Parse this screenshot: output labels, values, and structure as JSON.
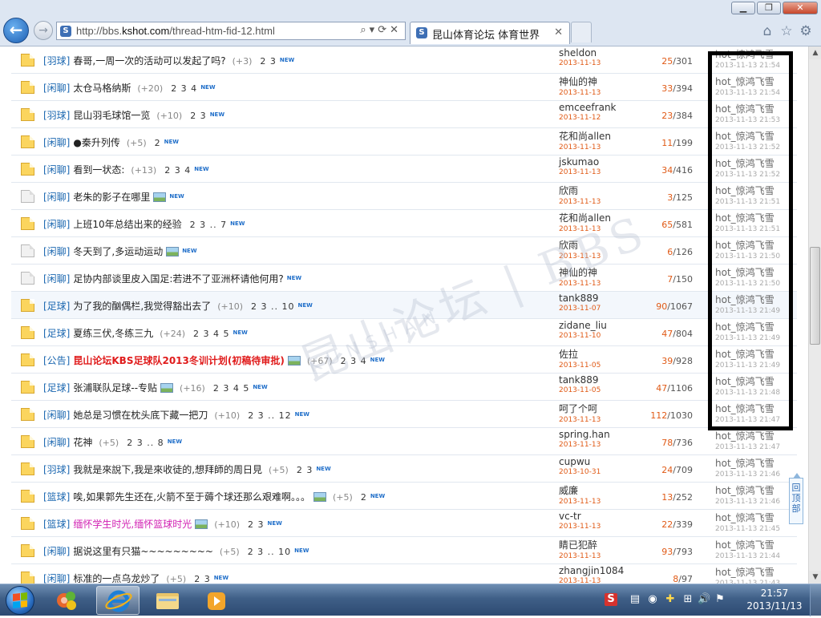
{
  "browser": {
    "url_prefix": "http://bbs.",
    "url_domain": "kshot.com",
    "url_path": "/thread-htm-fid-12.html",
    "tab_title": "昆山体育论坛 体育世界",
    "tab_close": "✕",
    "min_label": "▁",
    "max_label": "❐",
    "close_label": "✕",
    "back_glyph": "←",
    "fwd_glyph": "→",
    "address_tools": "⌕▾⟳✕",
    "home_glyph": "⌂",
    "fav_glyph": "☆",
    "gear_glyph": "⚙",
    "favicon_letter": "S"
  },
  "partial_top": {
    "stats": "/258",
    "last_date": "2013-11-13 21:55",
    "author_date": "2013-11-13"
  },
  "threads": [
    {
      "cat": "[羽球]",
      "title": "春哥,一周一次的活动可以发起了吗?",
      "plus": "(+3)",
      "pages": "2 3",
      "new": "NEW",
      "icon": "hot",
      "author": "sheldon",
      "adate": "2013-11-13",
      "replies": "25",
      "views": "/301",
      "last": "hot_惊鸿飞雪",
      "ldate": "2013-11-13 21:54"
    },
    {
      "cat": "[闲聊]",
      "title": "太仓马格纳斯",
      "plus": "(+20)",
      "pages": "2 3 4",
      "new": "NEW",
      "icon": "hot",
      "author": "神仙的神",
      "adate": "2013-11-13",
      "replies": "33",
      "views": "/394",
      "last": "hot_惊鸿飞雪",
      "ldate": "2013-11-13 21:54"
    },
    {
      "cat": "[羽球]",
      "title": "昆山羽毛球馆一览",
      "plus": "(+10)",
      "pages": "2 3",
      "new": "NEW",
      "icon": "hot",
      "author": "emceefrank",
      "adate": "2013-11-12",
      "replies": "23",
      "views": "/384",
      "last": "hot_惊鸿飞雪",
      "ldate": "2013-11-13 21:53"
    },
    {
      "cat": "[闲聊]",
      "title": "●秦升列传",
      "plus": "(+5)",
      "pages": "2",
      "new": "NEW",
      "icon": "hot",
      "author": "花和尚allen",
      "adate": "2013-11-13",
      "replies": "11",
      "views": "/199",
      "last": "hot_惊鸿飞雪",
      "ldate": "2013-11-13 21:52"
    },
    {
      "cat": "[闲聊]",
      "title": "看到一状态:",
      "plus": "(+13)",
      "pages": "2 3 4",
      "new": "NEW",
      "icon": "hot",
      "author": "jskumao",
      "adate": "2013-11-13",
      "replies": "34",
      "views": "/416",
      "last": "hot_惊鸿飞雪",
      "ldate": "2013-11-13 21:52"
    },
    {
      "cat": "[闲聊]",
      "title": "老朱的影子在哪里",
      "plus": "",
      "pages": "",
      "new": "NEW",
      "icon": "normal",
      "pic": true,
      "author": "欣雨",
      "adate": "2013-11-13",
      "replies": "3",
      "views": "/125",
      "last": "hot_惊鸿飞雪",
      "ldate": "2013-11-13 21:51"
    },
    {
      "cat": "[闲聊]",
      "title": "上班10年总结出来的经验",
      "plus": "",
      "pages": "2 3 .. 7",
      "new": "NEW",
      "icon": "hot",
      "author": "花和尚allen",
      "adate": "2013-11-13",
      "replies": "65",
      "views": "/581",
      "last": "hot_惊鸿飞雪",
      "ldate": "2013-11-13 21:51"
    },
    {
      "cat": "[闲聊]",
      "title": "冬天到了,多运动运动",
      "plus": "",
      "pages": "",
      "new": "NEW",
      "icon": "normal",
      "pic": true,
      "author": "欣雨",
      "adate": "2013-11-13",
      "replies": "6",
      "views": "/126",
      "last": "hot_惊鸿飞雪",
      "ldate": "2013-11-13 21:50"
    },
    {
      "cat": "[闲聊]",
      "title": "足协内部谈里皮入国足:若进不了亚洲杯请他何用?",
      "plus": "",
      "pages": "",
      "new": "NEW",
      "icon": "normal",
      "author": "神仙的神",
      "adate": "2013-11-13",
      "replies": "7",
      "views": "/150",
      "last": "hot_惊鸿飞雪",
      "ldate": "2013-11-13 21:50"
    },
    {
      "cat": "[足球]",
      "title": "为了我的酗偶栏,我觉得豁出去了",
      "plus": "(+10)",
      "pages": "2 3 .. 10",
      "new": "NEW",
      "icon": "hot",
      "author": "tank889",
      "adate": "2013-11-07",
      "replies": "90",
      "views": "/1067",
      "last": "hot_惊鸿飞雪",
      "ldate": "2013-11-13 21:49"
    },
    {
      "cat": "[足球]",
      "title": "夏练三伏,冬练三九",
      "plus": "(+24)",
      "pages": "2 3 4 5",
      "new": "NEW",
      "icon": "hot",
      "author": "zidane_liu",
      "adate": "2013-11-10",
      "replies": "47",
      "views": "/804",
      "last": "hot_惊鸿飞雪",
      "ldate": "2013-11-13 21:49"
    },
    {
      "cat": "[公告]",
      "title": "昆山论坛KBS足球队2013冬训计划(初稿待审批)",
      "plus": "(+67)",
      "pages": "2 3 4",
      "new": "NEW",
      "icon": "hot",
      "style": "red",
      "pic": true,
      "author": "佐拉",
      "adate": "2013-11-05",
      "replies": "39",
      "views": "/928",
      "last": "hot_惊鸿飞雪",
      "ldate": "2013-11-13 21:49"
    },
    {
      "cat": "[足球]",
      "title": "张浦联队足球--专贴",
      "plus": "(+16)",
      "pages": "2 3 4 5",
      "new": "NEW",
      "icon": "hot",
      "pic": true,
      "author": "tank889",
      "adate": "2013-11-05",
      "replies": "47",
      "views": "/1106",
      "last": "hot_惊鸿飞雪",
      "ldate": "2013-11-13 21:48"
    },
    {
      "cat": "[闲聊]",
      "title": "她总是习惯在枕头底下藏一把刀",
      "plus": "(+10)",
      "pages": "2 3 .. 12",
      "new": "NEW",
      "icon": "hot",
      "author": "呵了个呵",
      "adate": "2013-11-13",
      "replies": "112",
      "views": "/1030",
      "last": "hot_惊鸿飞雪",
      "ldate": "2013-11-13 21:47"
    },
    {
      "cat": "[闲聊]",
      "title": "花神",
      "plus": "(+5)",
      "pages": "2 3 .. 8",
      "new": "NEW",
      "icon": "hot",
      "author": "spring.han",
      "adate": "2013-11-13",
      "replies": "78",
      "views": "/736",
      "last": "hot_惊鸿飞雪",
      "ldate": "2013-11-13 21:47"
    },
    {
      "cat": "[羽球]",
      "title": "我就是來說下,我是來收徒的,想拜師的周日見",
      "plus": "(+5)",
      "pages": "2 3",
      "new": "NEW",
      "icon": "hot",
      "author": "cupwu",
      "adate": "2013-10-31",
      "replies": "24",
      "views": "/709",
      "last": "hot_惊鸿飞雪",
      "ldate": "2013-11-13 21:46"
    },
    {
      "cat": "[篮球]",
      "title": "唉,如果郭先生还在,火箭不至于薅个球还那么艰难啊。。。",
      "plus": "(+5)",
      "pages": "2",
      "new": "NEW",
      "icon": "hot",
      "pic": true,
      "author": "威廉",
      "adate": "2013-11-13",
      "replies": "13",
      "views": "/252",
      "last": "hot_惊鸿飞雪",
      "ldate": "2013-11-13 21:46"
    },
    {
      "cat": "[篮球]",
      "title": "缅怀学生时光,缅怀篮球时光",
      "plus": "(+10)",
      "pages": "2 3",
      "new": "NEW",
      "icon": "hot",
      "style": "pink",
      "pic": true,
      "author": "vc-tr",
      "adate": "2013-11-13",
      "replies": "22",
      "views": "/339",
      "last": "hot_惊鸿飞雪",
      "ldate": "2013-11-13 21:45"
    },
    {
      "cat": "[闲聊]",
      "title": "据说这里有只猫~~~~~~~~~",
      "plus": "(+5)",
      "pages": "2 3 .. 10",
      "new": "NEW",
      "icon": "hot",
      "author": "睛已犯醉",
      "adate": "2013-11-13",
      "replies": "93",
      "views": "/793",
      "last": "hot_惊鸿飞雪",
      "ldate": "2013-11-13 21:44"
    },
    {
      "cat": "[闲聊]",
      "title": "标准的一点乌龙炒了",
      "plus": "(+5)",
      "pages": "2 3",
      "new": "NEW",
      "icon": "hot",
      "author": "zhangjin1084",
      "adate": "2013-11-13",
      "replies": "8",
      "views": "/97",
      "last": "hot_惊鸿飞雪",
      "ldate": "2013-11-13 21:43"
    }
  ],
  "watermark": {
    "line1": "昆山论坛 | BBS",
    "line2": "KUNSHAN"
  },
  "back_to_top": "回顶部",
  "scroll": {
    "up": "▲",
    "down": "▼"
  },
  "taskbar": {
    "clock_time": "21:57",
    "clock_date": "2013/11/13",
    "tray_icons": [
      "S",
      "▤",
      "◉",
      "✚",
      "⊞",
      "🔊",
      "⚑"
    ]
  },
  "colors": {
    "link": "#1b67b0",
    "date": "#e05a16",
    "sticky_red": "#e01b1b",
    "pink": "#d11fb2"
  }
}
